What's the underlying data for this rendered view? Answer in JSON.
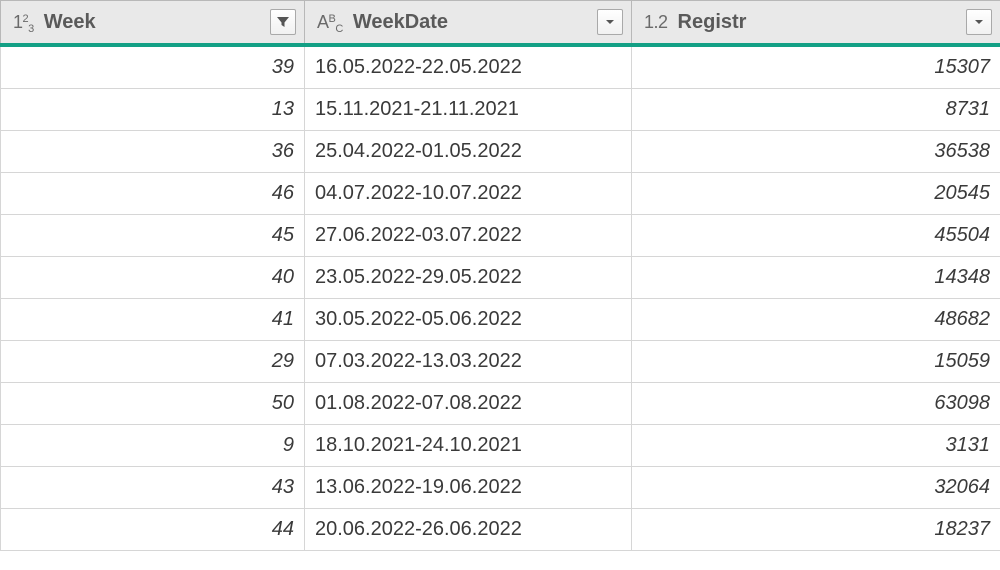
{
  "columns": {
    "week": {
      "label": "Week",
      "type_icon": "int-icon",
      "filter_state": "filtered"
    },
    "date": {
      "label": "WeekDate",
      "type_icon": "text-icon",
      "filter_state": "none"
    },
    "registr": {
      "label": "Registr",
      "type_icon": "decimal-icon",
      "filter_state": "none"
    }
  },
  "type_glyphs": {
    "int-icon": {
      "a": "1",
      "b": "2",
      "c": "3"
    },
    "text-icon": {
      "a": "A",
      "b": "B",
      "c": "C"
    },
    "decimal-icon": {
      "a": "1.2"
    }
  },
  "rows": [
    {
      "week": "39",
      "date": "16.05.2022-22.05.2022",
      "registr": "15307"
    },
    {
      "week": "13",
      "date": "15.11.2021-21.11.2021",
      "registr": "8731"
    },
    {
      "week": "36",
      "date": "25.04.2022-01.05.2022",
      "registr": "36538"
    },
    {
      "week": "46",
      "date": "04.07.2022-10.07.2022",
      "registr": "20545"
    },
    {
      "week": "45",
      "date": "27.06.2022-03.07.2022",
      "registr": "45504"
    },
    {
      "week": "40",
      "date": "23.05.2022-29.05.2022",
      "registr": "14348"
    },
    {
      "week": "41",
      "date": "30.05.2022-05.06.2022",
      "registr": "48682"
    },
    {
      "week": "29",
      "date": "07.03.2022-13.03.2022",
      "registr": "15059"
    },
    {
      "week": "50",
      "date": "01.08.2022-07.08.2022",
      "registr": "63098"
    },
    {
      "week": "9",
      "date": "18.10.2021-24.10.2021",
      "registr": "3131"
    },
    {
      "week": "43",
      "date": "13.06.2022-19.06.2022",
      "registr": "32064"
    },
    {
      "week": "44",
      "date": "20.06.2022-26.06.2022",
      "registr": "18237"
    }
  ],
  "colors": {
    "accent": "#13a085",
    "header_bg": "#e9e9e9",
    "grid_line": "#d6d6d6"
  }
}
